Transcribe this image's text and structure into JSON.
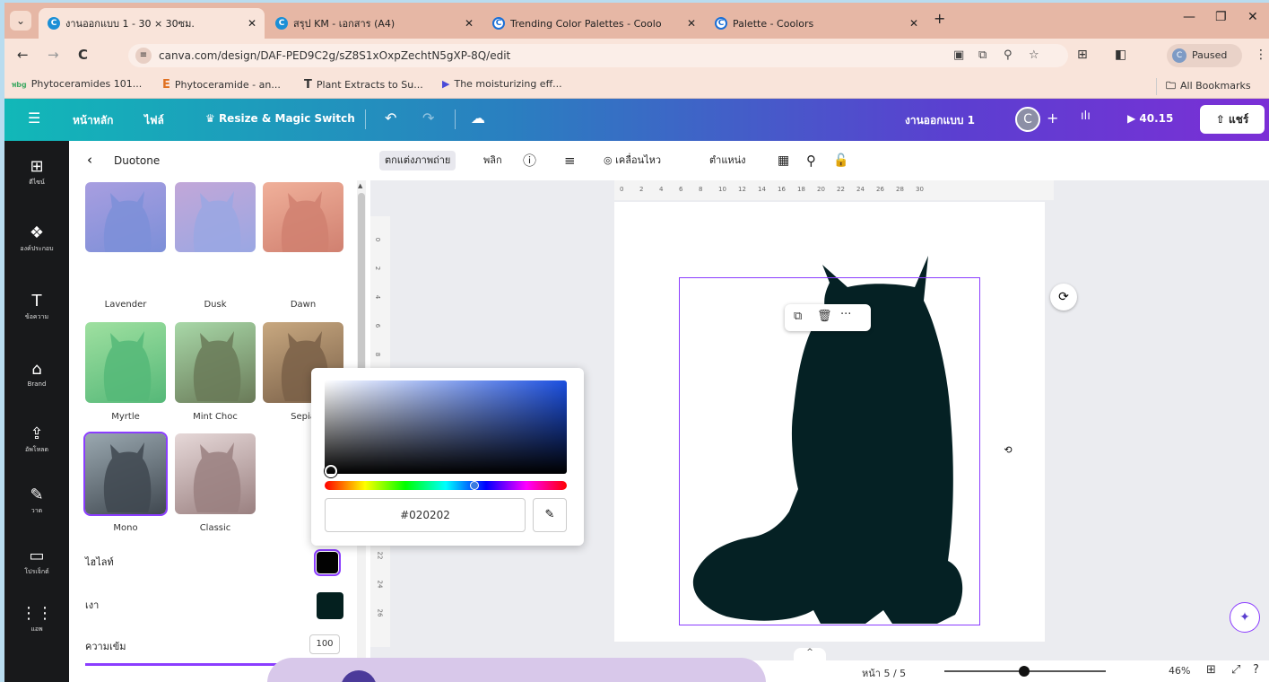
{
  "browser": {
    "tabs": [
      {
        "title": "งานออกแบบ 1 - 30 × 30ซม.",
        "favicon": "C"
      },
      {
        "title": "สรุป KM - เอกสาร (A4)",
        "favicon": "C"
      },
      {
        "title": "Trending Color Palettes - Coolo",
        "favicon": "C"
      },
      {
        "title": "Palette - Coolors",
        "favicon": "C"
      }
    ],
    "new_tab": "+",
    "url": "canva.com/design/DAF-PED9C2g/sZ8S1xOxpZechtN5gXP-8Q/edit",
    "profile_initial": "C",
    "profile_status": "Paused",
    "bookmarks": [
      {
        "icon": "พbg",
        "label": "Phytoceramides 101..."
      },
      {
        "icon": "E",
        "label": "Phytoceramide - an..."
      },
      {
        "icon": "T",
        "label": "Plant Extracts to Su..."
      },
      {
        "icon": "▶",
        "label": "The moisturizing eff..."
      }
    ],
    "all_bookmarks": "All Bookmarks"
  },
  "canva": {
    "header": {
      "home": "หน้าหลัก",
      "file": "ไฟล์",
      "resize": "Resize & Magic Switch",
      "design_name": "งานออกแบบ 1",
      "avatar_initial": "C",
      "present_time": "40.15",
      "share": "แชร์"
    },
    "rail": [
      {
        "icon": "design-icon",
        "glyph": "⊞",
        "label": "ดีไซน์"
      },
      {
        "icon": "elements-icon",
        "glyph": "❖",
        "label": "องค์ประกอบ"
      },
      {
        "icon": "text-icon",
        "glyph": "T",
        "label": "ข้อความ"
      },
      {
        "icon": "brand-icon",
        "glyph": "⌂",
        "label": "Brand"
      },
      {
        "icon": "upload-icon",
        "glyph": "⇪",
        "label": "อัพโหลด"
      },
      {
        "icon": "draw-icon",
        "glyph": "✎",
        "label": "วาด"
      },
      {
        "icon": "projects-icon",
        "glyph": "▭",
        "label": "โปรเจ็กต์"
      },
      {
        "icon": "apps-icon",
        "glyph": "⋮⋮",
        "label": "แอพ"
      }
    ],
    "panel": {
      "title": "Duotone",
      "presets": [
        {
          "name": "Lavender",
          "colors": [
            "#a89ee0",
            "#7c8fd8"
          ]
        },
        {
          "name": "Dusk",
          "colors": [
            "#c2a7d8",
            "#9aa7e3"
          ]
        },
        {
          "name": "Dawn",
          "colors": [
            "#f0b09a",
            "#d08070"
          ]
        },
        {
          "name": "Myrtle",
          "colors": [
            "#9fe0a0",
            "#55b878"
          ]
        },
        {
          "name": "Mint Choc",
          "colors": [
            "#a8d8a8",
            "#6a7a58"
          ]
        },
        {
          "name": "Sepia",
          "colors": [
            "#c8a880",
            "#7a6048"
          ]
        },
        {
          "name": "Mono",
          "colors": [
            "#9aa8b0",
            "#404850"
          ]
        },
        {
          "name": "Classic",
          "colors": [
            "#e6d8d8",
            "#9a8080"
          ]
        }
      ],
      "highlight_label": "ไฮไลท์",
      "highlight_color": "#020202",
      "shadow_label": "เงา",
      "shadow_color": "#04201f",
      "intensity_label": "ความเข้ม",
      "intensity_value": "100"
    },
    "toolbar": {
      "edit_photo": "ตกแต่งภาพถ่าย",
      "flip": "พลิก",
      "animate": "เคลื่อนไหว",
      "position": "ตำแหน่ง"
    },
    "ruler_h": [
      "0",
      "2",
      "4",
      "6",
      "8",
      "10",
      "12",
      "14",
      "16",
      "18",
      "20",
      "22",
      "24",
      "26",
      "28",
      "30"
    ],
    "ruler_v": [
      "0",
      "2",
      "4",
      "6",
      "8",
      "",
      "",
      "",
      "",
      "",
      "",
      "22",
      "24",
      "26"
    ],
    "picker": {
      "hex": "#020202",
      "hue_position": 0.6
    },
    "bottom": {
      "page_label": "หน้า 5 / 5",
      "zoom": "46%",
      "zoom_level": 0.46
    }
  }
}
